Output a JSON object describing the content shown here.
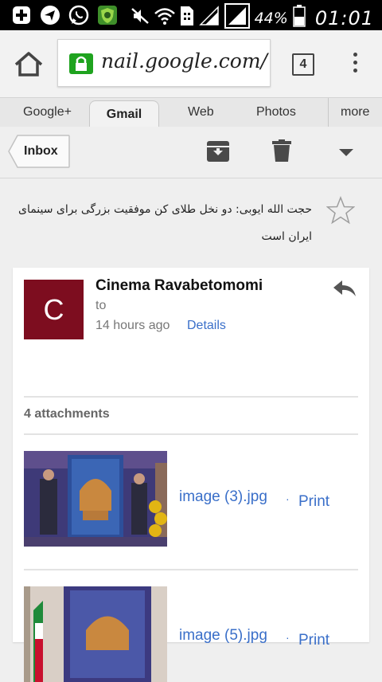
{
  "status_bar": {
    "battery": "44%",
    "time": "01:01",
    "icons": [
      "add-notification-icon",
      "navigation-icon",
      "whatsapp-icon",
      "shield-app-icon",
      "muted-icon",
      "wifi-icon",
      "sim-icon",
      "signal-icon",
      "signal-icon",
      "battery-icon"
    ]
  },
  "browser": {
    "url": "nail.google.com/",
    "tab_count": "4"
  },
  "google_bar": {
    "tabs": [
      "Google+",
      "Gmail",
      "Web",
      "Photos",
      "more"
    ],
    "active": "Gmail"
  },
  "gmail": {
    "back_label": "Inbox",
    "subject": "حجت الله ایوبی: دو نخل طلای کن موفقیت بزرگی برای سینمای ایران است",
    "message": {
      "avatar_letter": "C",
      "avatar_color": "#7d0d1f",
      "sender": "Cinema Ravabetomomi",
      "to_label": "to",
      "time": "14 hours ago",
      "details_label": "Details"
    },
    "attachments": {
      "count_label": "4 attachments",
      "items": [
        {
          "name": "image (3).jpg",
          "separator": "·",
          "print_label": "Print"
        },
        {
          "name": "image (5).jpg",
          "separator": "·",
          "print_label": "Print"
        }
      ]
    }
  },
  "colors": {
    "link": "#3a6fc9",
    "avatar": "#7d0d1f",
    "secure": "#1fa31f"
  }
}
